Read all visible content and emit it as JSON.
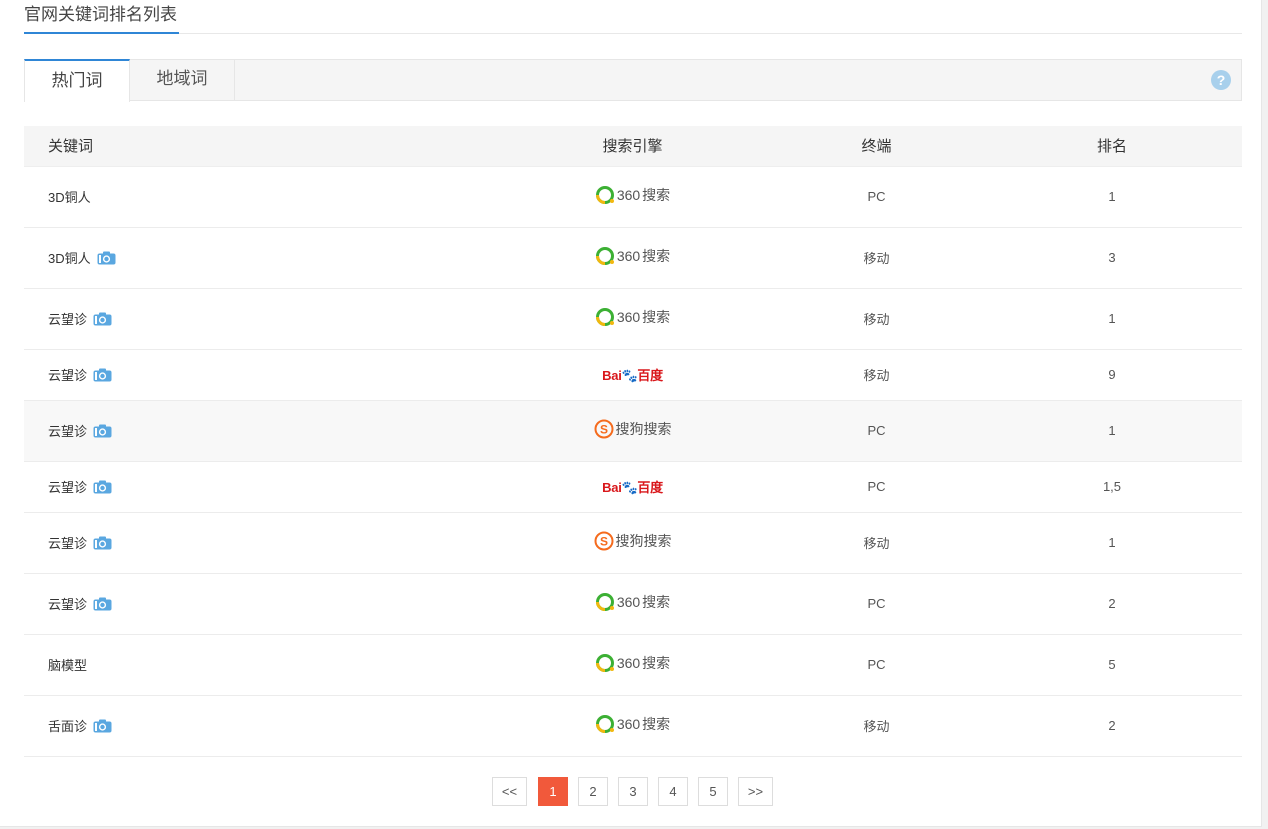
{
  "page": {
    "title": "官网关键词排名列表"
  },
  "tabs": [
    {
      "label": "热门词",
      "active": true
    },
    {
      "label": "地域词",
      "active": false
    }
  ],
  "help": {
    "symbol": "?"
  },
  "table": {
    "headers": [
      "关键词",
      "搜索引擎",
      "终端",
      "排名"
    ],
    "rows": [
      {
        "keyword": "3D铜人",
        "snapshot": false,
        "engine": "360",
        "engine_label": "360搜索",
        "terminal": "PC",
        "rank": "1"
      },
      {
        "keyword": "3D铜人",
        "snapshot": true,
        "engine": "360",
        "engine_label": "360搜索",
        "terminal": "移动",
        "rank": "3"
      },
      {
        "keyword": "云望诊",
        "snapshot": true,
        "engine": "360",
        "engine_label": "360搜索",
        "terminal": "移动",
        "rank": "1"
      },
      {
        "keyword": "云望诊",
        "snapshot": true,
        "engine": "baidu",
        "engine_label": "Bai百度",
        "terminal": "移动",
        "rank": "9"
      },
      {
        "keyword": "云望诊",
        "snapshot": true,
        "engine": "sogou",
        "engine_label": "搜狗搜索",
        "terminal": "PC",
        "rank": "1"
      },
      {
        "keyword": "云望诊",
        "snapshot": true,
        "engine": "baidu",
        "engine_label": "Bai百度",
        "terminal": "PC",
        "rank": "1,5"
      },
      {
        "keyword": "云望诊",
        "snapshot": true,
        "engine": "sogou",
        "engine_label": "搜狗搜索",
        "terminal": "移动",
        "rank": "1"
      },
      {
        "keyword": "云望诊",
        "snapshot": true,
        "engine": "360",
        "engine_label": "360搜索",
        "terminal": "PC",
        "rank": "2"
      },
      {
        "keyword": "脑模型",
        "snapshot": false,
        "engine": "360",
        "engine_label": "360搜索",
        "terminal": "PC",
        "rank": "5"
      },
      {
        "keyword": "舌面诊",
        "snapshot": true,
        "engine": "360",
        "engine_label": "360搜索",
        "terminal": "移动",
        "rank": "2"
      }
    ]
  },
  "pagination": {
    "prev": "<<",
    "pages": [
      "1",
      "2",
      "3",
      "4",
      "5"
    ],
    "current": "1",
    "next": ">>"
  },
  "colors": {
    "accent": "#2f86d6",
    "active_page": "#f1593b"
  }
}
